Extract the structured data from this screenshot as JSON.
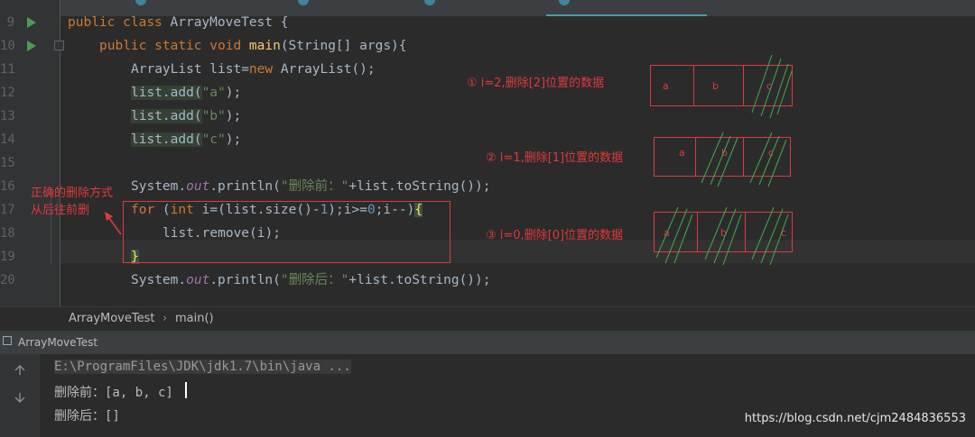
{
  "editor": {
    "line_numbers": [
      "9",
      "10",
      "11",
      "12",
      "13",
      "14",
      "15",
      "16",
      "17",
      "18",
      "19",
      "20"
    ],
    "code": {
      "l9_kw1": "public",
      "l9_kw2": "class",
      "l9_name": "ArrayMoveTest",
      "l9_brace": "{",
      "l10_kw1": "public",
      "l10_kw2": "static",
      "l10_kw3": "void",
      "l10_fn": "main",
      "l10_rest": "(String[] args){",
      "l11_a": "ArrayList list=",
      "l11_kw": "new",
      "l11_b": " ArrayList();",
      "l12_a": "list.add(",
      "l12_s": "\"a\"",
      "l12_b": ");",
      "l13_a": "list.add(",
      "l13_s": "\"b\"",
      "l13_b": ");",
      "l14_a": "list.add(",
      "l14_s": "\"c\"",
      "l14_b": ");",
      "l16_a": "System.",
      "l16_out": "out",
      "l16_b": ".println(",
      "l16_s": "\"删除前：\"",
      "l16_c": "+list.toString());",
      "l17_for": "for",
      "l17_a": " (",
      "l17_int": "int",
      "l17_b": " i=(list.size()-",
      "l17_one": "1",
      "l17_c": ");i>=",
      "l17_zero": "0",
      "l17_d": ";i--)",
      "l17_brace": "{",
      "l18": "list.remove(i);",
      "l19_brace": "}",
      "l20_a": "System.",
      "l20_out": "out",
      "l20_b": ".println(",
      "l20_s": "\"删除后：\"",
      "l20_c": "+list.toString());"
    }
  },
  "annotations": {
    "correct_way_line1": "正确的删除方式",
    "correct_way_line2": "从后往前删",
    "step1": "① i=2,删除[2]位置的数据",
    "step2": "② i=1,删除[1]位置的数据",
    "step3": "③ i=0,删除[0]位置的数据",
    "cells": [
      "a",
      "b",
      "c"
    ]
  },
  "breadcrumb": {
    "class_name": "ArrayMoveTest",
    "separator": "›",
    "method": "main()"
  },
  "run_toolbar": {
    "title": "ArrayMoveTest"
  },
  "console": {
    "command": "E:\\ProgramFiles\\JDK\\jdk1.7\\bin\\java ...",
    "output_before": "删除前：[a, b, c]",
    "output_after": "删除后：[]"
  },
  "watermark": "https://blog.csdn.net/cjm2484836553",
  "colors": {
    "annotation_red": "#e0393e",
    "strike_green": "#3fa34d",
    "keyword": "#cc7832",
    "string": "#6a8759"
  }
}
